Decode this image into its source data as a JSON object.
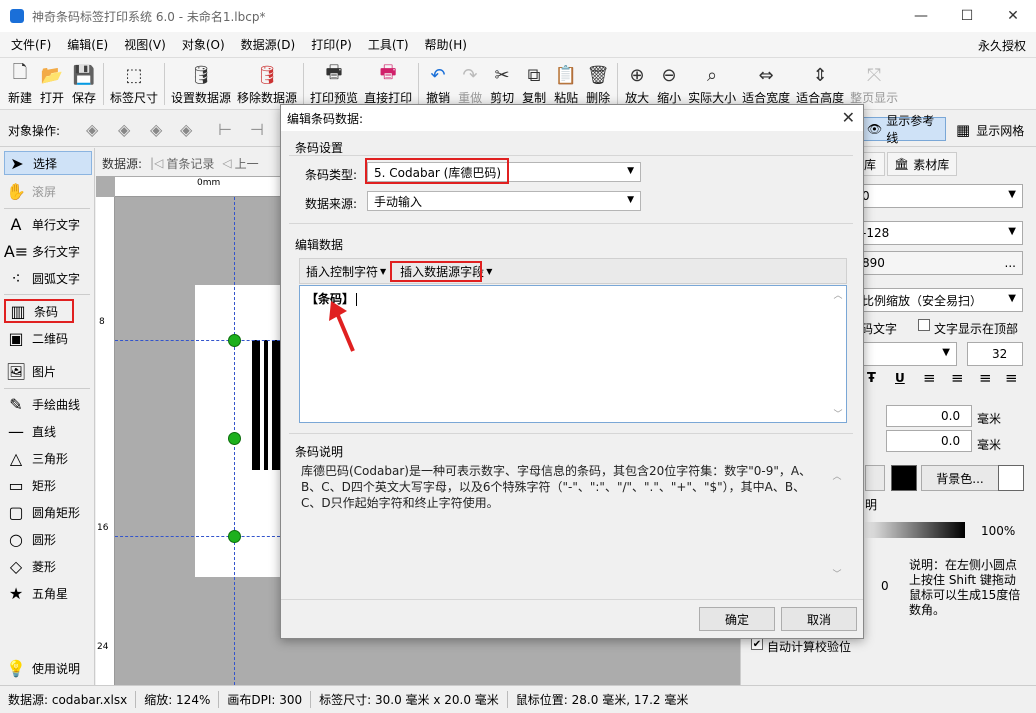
{
  "window": {
    "title": "神奇条码标签打印系统 6.0 - 未命名1.lbcp*",
    "controls": [
      "—",
      "☐",
      "✕"
    ]
  },
  "menu": {
    "items": [
      "文件(F)",
      "编辑(E)",
      "视图(V)",
      "对象(O)",
      "数据源(D)",
      "打印(P)",
      "工具(T)",
      "帮助(H)"
    ],
    "license": "永久授权"
  },
  "toolbar": {
    "new": "新建",
    "open": "打开",
    "save": "保存",
    "label_size": "标签尺寸",
    "set_datasource": "设置数据源",
    "remove_datasource": "移除数据源",
    "print_preview": "打印预览",
    "direct_print": "直接打印",
    "undo": "撤销",
    "redo": "重做",
    "cut": "剪切",
    "copy": "复制",
    "paste": "粘贴",
    "delete": "删除",
    "zoom_in": "放大",
    "zoom_out": "缩小",
    "actual_size": "实际大小",
    "fit_width": "适合宽度",
    "fit_height": "适合高度",
    "whole_page": "整页显示"
  },
  "objbar": {
    "label": "对象操作:",
    "show_guides": "显示参考线",
    "show_grid": "显示网格"
  },
  "left_tools": {
    "select": "选择",
    "scroll": "滚屏",
    "single_text": "单行文字",
    "multi_text": "多行文字",
    "arc_text": "圆弧文字",
    "barcode": "条码",
    "qrcode": "二维码",
    "image": "图片",
    "freehand": "手绘曲线",
    "line": "直线",
    "triangle": "三角形",
    "rect": "矩形",
    "round_rect": "圆角矩形",
    "circle": "圆形",
    "diamond": "菱形",
    "star": "五角星",
    "help": "使用说明"
  },
  "datasource_bar": {
    "label": "数据源:",
    "first": "首条记录",
    "prev": "上一"
  },
  "rulers": {
    "top_origin": "0mm",
    "left_marks": [
      "8",
      "16",
      "24"
    ]
  },
  "right_panel": {
    "tab_lib": "库",
    "tab_material": "素材库",
    "field1": "0",
    "field2": "-128",
    "field3": "890",
    "field3_btn": "...",
    "scale_mode": "比例缩放（安全易扫）",
    "show_text": "码文字",
    "text_on_top": "文字显示在顶部",
    "font_size": "32",
    "x_value": "0.0",
    "y_value": "0.0",
    "unit_mm": "毫米",
    "unit_mm2": "毫米",
    "bg_color_btn": "背景色...",
    "transparency_label": "明",
    "transparency_value": "100%",
    "rotate_value": "0",
    "rotate_note": "说明：在左侧小圆点上按住 Shift 键拖动鼠标可以生成15度倍数角。",
    "auto_checksum": "自动计算校验位"
  },
  "status": {
    "datasource": "数据源: codabar.xlsx",
    "zoom": "缩放: 124%",
    "dpi": "画布DPI: 300",
    "label_size": "标签尺寸: 30.0 毫米 x 20.0 毫米",
    "cursor": "鼠标位置: 28.0 毫米, 17.2 毫米"
  },
  "dialog": {
    "title": "编辑条码数据:",
    "close": "✕",
    "group_barcode_settings": "条码设置",
    "type_label": "条码类型:",
    "type_value": "5.  Codabar (库德巴码)",
    "source_label": "数据来源:",
    "source_value": "手动输入",
    "group_edit": "编辑数据",
    "insert_control": "插入控制字符",
    "insert_field": "插入数据源字段",
    "editor_content": "【条码】",
    "group_desc": "条码说明",
    "description": "库德巴码(Codabar)是一种可表示数字、字母信息的条码，其包含20位字符集：数字\"0-9\"，A、B、C、D四个英文大写字母，以及6个特殊字符（\"-\"、\":\"、\"/\"、\".\"、\"+\"、\"$\"），其中A、B、C、D只作起始字符和终止字符使用。",
    "ok": "确定",
    "cancel": "取消"
  },
  "colors": {
    "accent": "#1a6fd8",
    "highlight_red": "#e02020",
    "handle_green": "#1db01d"
  }
}
